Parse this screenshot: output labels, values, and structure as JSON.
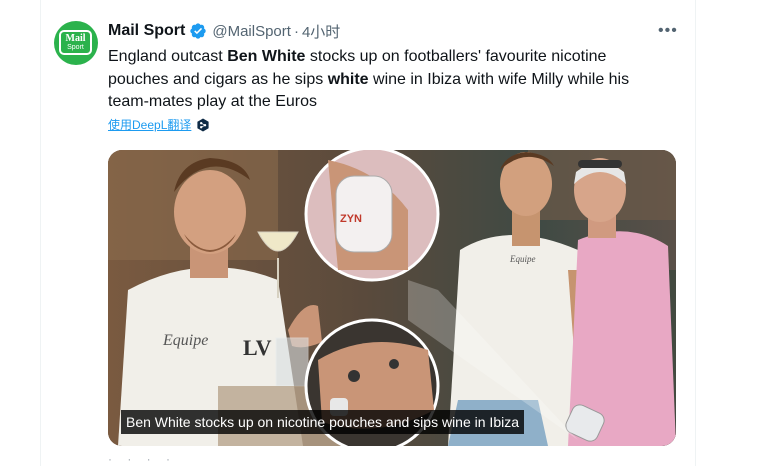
{
  "account": {
    "name": "Mail Sport",
    "handle": "@MailSport",
    "separator": "·",
    "time": "4小时",
    "avatar_line1": "Mail",
    "avatar_line2": "Sport"
  },
  "tweet": {
    "t1": "England outcast ",
    "b1": "Ben White",
    "t2": " stocks up on footballers' favourite nicotine pouches and cigars as he sips ",
    "b2": "white",
    "t3": " wine in Ibiza with wife Milly while his team-mates play at the Euros"
  },
  "translate_label": "使用DeepL翻译",
  "image": {
    "caption": "Ben White stocks up on nicotine pouches and sips wine in Ibiza"
  },
  "footer_text": "· · · ·",
  "colors": {
    "brand_green": "#2bb24c",
    "verified_blue": "#1d9bf0",
    "link_blue": "#1d9bf0"
  },
  "icons": {
    "verified": "verified-badge-icon",
    "more": "more-options-icon",
    "translate": "deepl-icon"
  }
}
